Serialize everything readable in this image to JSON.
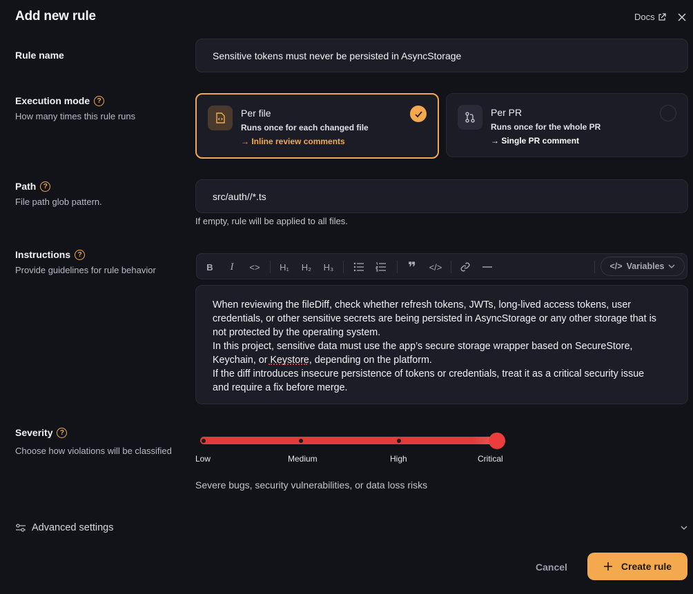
{
  "header": {
    "title": "Add new rule",
    "docs_label": "Docs"
  },
  "rule_name": {
    "label": "Rule name",
    "value": "Sensitive tokens must never be persisted in AsyncStorage"
  },
  "execution_mode": {
    "label": "Execution mode",
    "description": "How many times this rule runs",
    "options": [
      {
        "title": "Per file",
        "description": "Runs once for each changed file",
        "output": "→ Inline review comments",
        "selected": true
      },
      {
        "title": "Per PR",
        "description": "Runs once for the whole PR",
        "output": "→ Single PR comment",
        "selected": false
      }
    ]
  },
  "path": {
    "label": "Path",
    "description": "File path glob pattern.",
    "value": "src/auth//*.ts",
    "hint": "If empty, rule will be applied to all files."
  },
  "instructions": {
    "label": "Instructions",
    "description": "Provide guidelines for rule behavior",
    "toolbar": {
      "h1": "H₁",
      "h2": "H₂",
      "h3": "H₃",
      "variables_label": "Variables"
    },
    "lines": [
      "When reviewing the fileDiff, check whether refresh tokens, JWTs, long-lived access tokens, user",
      "credentials, or other sensitive secrets are being persisted in AsyncStorage or any other storage that is",
      "not protected by the operating system.",
      "In this project, sensitive data must use the app’s secure storage wrapper based on SecureStore,",
      "Keychain, or Keystore, depending on the platform.",
      "If the diff introduces insecure persistence of tokens or credentials, treat it as a critical security issue",
      "and require a fix before merge."
    ]
  },
  "severity": {
    "label": "Severity",
    "description": "Choose how violations will be classified",
    "levels": [
      "Low",
      "Medium",
      "High",
      "Critical"
    ],
    "selected": "Critical",
    "selected_index": 3,
    "level_description": "Severe bugs, security vulnerabilities, or data loss risks",
    "color": "#ea3d3d"
  },
  "advanced": {
    "label": "Advanced settings"
  },
  "actions": {
    "cancel_label": "Cancel",
    "create_label": "Create rule"
  },
  "colors": {
    "accent": "#f4a94e",
    "background": "#121219",
    "danger": "#ea3d3d"
  }
}
